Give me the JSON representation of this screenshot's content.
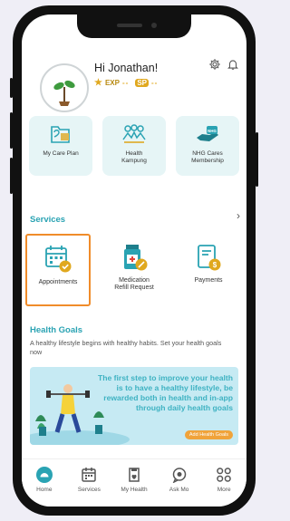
{
  "header": {
    "greeting": "Hi Jonathan!",
    "exp_label": "EXP",
    "exp_value": "--",
    "sp_label": "SP",
    "sp_value": "--"
  },
  "quick_cards": [
    {
      "label": "My Care Plan",
      "icon": "care-plan-icon"
    },
    {
      "label": "Health\nKampung",
      "icon": "community-icon"
    },
    {
      "label": "NHG Cares\nMembership",
      "icon": "nhg-cares-icon"
    }
  ],
  "services": {
    "title": "Services",
    "items": [
      {
        "label": "Appointments",
        "icon": "calendar-check-icon",
        "selected": true
      },
      {
        "label": "Medication\nRefill Request",
        "icon": "medication-icon",
        "selected": false
      },
      {
        "label": "Payments",
        "icon": "payment-icon",
        "selected": false
      }
    ]
  },
  "health_goals": {
    "title": "Health Goals",
    "description": "A healthy lifestyle begins with healthy habits. Set your health goals now",
    "banner_text": "The first step to improve your health is to have a healthy lifestyle, be rewarded both in health and in-app through daily health goals",
    "button_label": "Add Health Goals"
  },
  "tabbar": [
    {
      "label": "Home",
      "icon": "home-icon",
      "active": true
    },
    {
      "label": "Services",
      "icon": "services-icon",
      "active": false
    },
    {
      "label": "My Health",
      "icon": "my-health-icon",
      "active": false
    },
    {
      "label": "Ask Mo",
      "icon": "chat-icon",
      "active": false
    },
    {
      "label": "More",
      "icon": "more-icon",
      "active": false
    }
  ],
  "colors": {
    "accent": "#2aa3b3",
    "selection_border": "#f08c2a",
    "card_bg": "#e6f5f6",
    "banner_bg": "#c6eaf3"
  }
}
